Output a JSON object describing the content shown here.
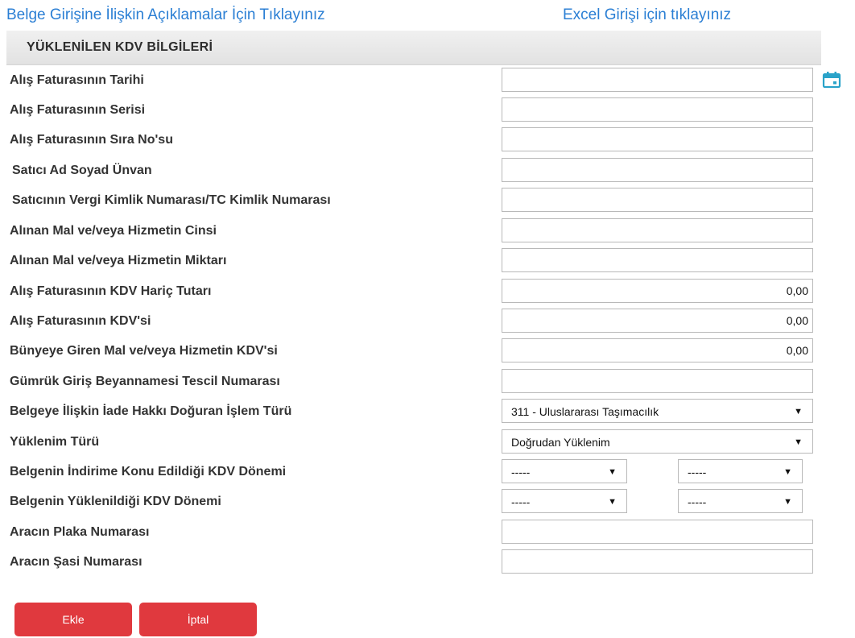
{
  "links": {
    "description": "Belge Girişine İlişkin Açıklamalar İçin Tıklayınız",
    "excel": "Excel Girişi için tıklayınız"
  },
  "section": {
    "title": "YÜKLENİLEN KDV BİLGİLERİ"
  },
  "fields": {
    "invoice_date": {
      "label": "Alış Faturasının Tarihi",
      "value": ""
    },
    "invoice_series": {
      "label": "Alış Faturasının Serisi",
      "value": ""
    },
    "invoice_number": {
      "label": "Alış Faturasının Sıra No'su",
      "value": ""
    },
    "seller_name": {
      "label": "Satıcı Ad Soyad Ünvan",
      "value": ""
    },
    "seller_tax_id": {
      "label": "Satıcının Vergi Kimlik Numarası/TC Kimlik Numarası",
      "value": ""
    },
    "goods_type": {
      "label": "Alınan Mal ve/veya Hizmetin Cinsi",
      "value": ""
    },
    "goods_quantity": {
      "label": "Alınan Mal ve/veya Hizmetin Miktarı",
      "value": ""
    },
    "amount_excl_vat": {
      "label": "Alış Faturasının KDV Hariç Tutarı",
      "value": "0,00"
    },
    "invoice_vat": {
      "label": "Alış Faturasının KDV'si",
      "value": "0,00"
    },
    "included_vat": {
      "label": "Bünyeye Giren Mal ve/veya Hizmetin KDV'si",
      "value": "0,00"
    },
    "customs_declaration": {
      "label": "Gümrük Giriş Beyannamesi Tescil Numarası",
      "value": ""
    },
    "refund_transaction_type": {
      "label": "Belgeye İlişkin İade Hakkı Doğuran İşlem Türü",
      "selected": "311 - Uluslararası Taşımacılık"
    },
    "incurred_type": {
      "label": "Yüklenim Türü",
      "selected": "Doğrudan Yüklenim"
    },
    "deduction_period": {
      "label": "Belgenin İndirime Konu Edildiği KDV Dönemi",
      "selected_1": "-----",
      "selected_2": "-----"
    },
    "incurred_period": {
      "label": "Belgenin Yüklenildiği KDV Dönemi",
      "selected_1": "-----",
      "selected_2": "-----"
    },
    "plate_number": {
      "label": "Aracın Plaka Numarası",
      "value": ""
    },
    "chassis_number": {
      "label": "Aracın Şasi Numarası",
      "value": ""
    }
  },
  "icons": {
    "calendar": "calendar-icon",
    "dropdown": "triangle-down"
  },
  "dropdown_arrow": "▼",
  "buttons": {
    "add": "Ekle",
    "cancel": "İptal"
  },
  "colors": {
    "link": "#2b7fd4",
    "button": "#e0393e",
    "header_bg": "#e8e8e8",
    "calendar": "#2aa3c9"
  }
}
